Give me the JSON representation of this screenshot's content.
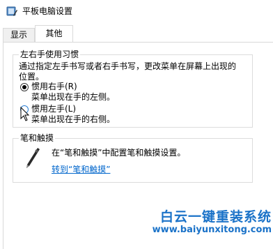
{
  "window": {
    "title": "平板电脑设置"
  },
  "tabs": [
    {
      "label": "显示"
    },
    {
      "label": "其他"
    }
  ],
  "handedness": {
    "group_title": "左右手使用习惯",
    "description": "通过指定左手书写或者右手书写，更改菜单在屏幕上出现的位置。",
    "options": [
      {
        "label": "惯用右手(R)",
        "sub": "菜单出现在手的左侧。",
        "selected": true
      },
      {
        "label": "惯用左手(L)",
        "sub": "菜单出现在手的右侧。",
        "selected": false
      }
    ]
  },
  "pen": {
    "group_title": "笔和触摸",
    "text": "在“笔和触摸”中配置笔和触摸设置。",
    "link": "转到“笔和触摸”",
    "icon": "pen-icon"
  },
  "watermark": {
    "title": "白云一键重装系统",
    "url": "www.baiyunxitong.com"
  },
  "colors": {
    "link": "#0066cc",
    "watermark": "#1a72c8"
  }
}
